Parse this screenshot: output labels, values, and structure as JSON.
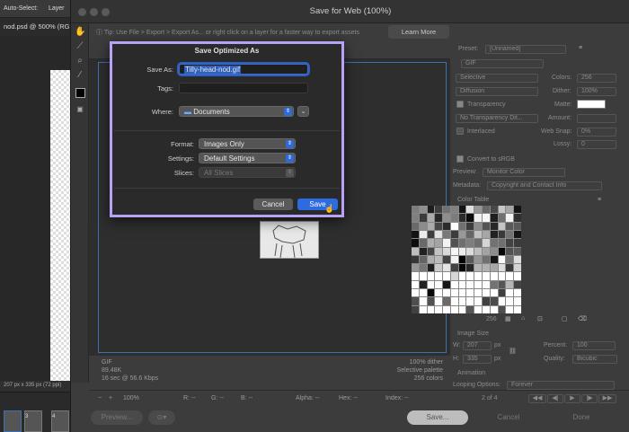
{
  "photoshop": {
    "toolbar_autoselect": "Auto-Select:",
    "toolbar_layer": "Layer",
    "doc_tab": "nod.psd @ 500% (RG",
    "status": "207 px x 335 px (72 ppi)",
    "thumbs": [
      "1",
      "3",
      "4"
    ]
  },
  "dialog": {
    "title": "Save for Web (100%)",
    "tip": "Tip: Use File > Export > Export As... or right click on a layer for a faster way to export assets",
    "learn_more": "Learn More",
    "preview_info_left": [
      "GIF",
      "89.48K",
      "16 sec @ 56.6 Kbps"
    ],
    "preview_info_right": [
      "100% dither",
      "Selective palette",
      "256 colors"
    ],
    "bottom_fields": {
      "zoom": "100%",
      "r": "R: --",
      "g": "G: --",
      "b": "B: --",
      "alpha": "Alpha: --",
      "hex": "Hex: --",
      "index": "Index: --"
    },
    "buttons": {
      "preview": "Preview...",
      "save": "Save...",
      "cancel": "Cancel",
      "done": "Done"
    }
  },
  "settings_panel": {
    "preset_label": "Preset:",
    "preset_value": "[Unnamed]",
    "format": "GIF",
    "reduction": "Selective",
    "colors_label": "Colors:",
    "colors_value": "256",
    "dither_algo": "Diffusion",
    "dither_label": "Dither:",
    "dither_value": "100%",
    "transparency_label": "Transparency",
    "matte_label": "Matte:",
    "transparency_dither": "No Transparency Dit...",
    "amount_label": "Amount:",
    "interlaced_label": "Interlaced",
    "websnap_label": "Web Snap:",
    "websnap_value": "0%",
    "lossy_label": "Lossy:",
    "lossy_value": "0",
    "convert_srgb": "Convert to sRGB",
    "preview_label": "Preview:",
    "preview_value": "Monitor Color",
    "metadata_label": "Metadata:",
    "metadata_value": "Copyright and Contact Info",
    "color_table_label": "Color Table",
    "color_count": "256",
    "image_size_label": "Image Size",
    "w_label": "W:",
    "w_value": "207",
    "h_label": "H:",
    "h_value": "335",
    "px": "px",
    "percent_label": "Percent:",
    "percent_value": "100",
    "quality_label": "Quality:",
    "quality_value": "Bicubic",
    "animation_label": "Animation",
    "looping_label": "Looping Options:",
    "looping_value": "Forever",
    "frame_counter": "2 of 4"
  },
  "save_sheet": {
    "title": "Save Optimized As",
    "save_as_label": "Save As:",
    "filename": "Tilly-head-nod.gif",
    "tags_label": "Tags:",
    "where_label": "Where:",
    "where_value": "Documents",
    "format_label": "Format:",
    "format_value": "Images Only",
    "settings_label": "Settings:",
    "settings_value": "Default Settings",
    "slices_label": "Slices:",
    "slices_value": "All Slices",
    "cancel": "Cancel",
    "save": "Save"
  },
  "colors": {
    "sheet_border": "#b8a2f5",
    "primary_button": "#2d6be0",
    "preview_border": "#3d6fb3"
  }
}
